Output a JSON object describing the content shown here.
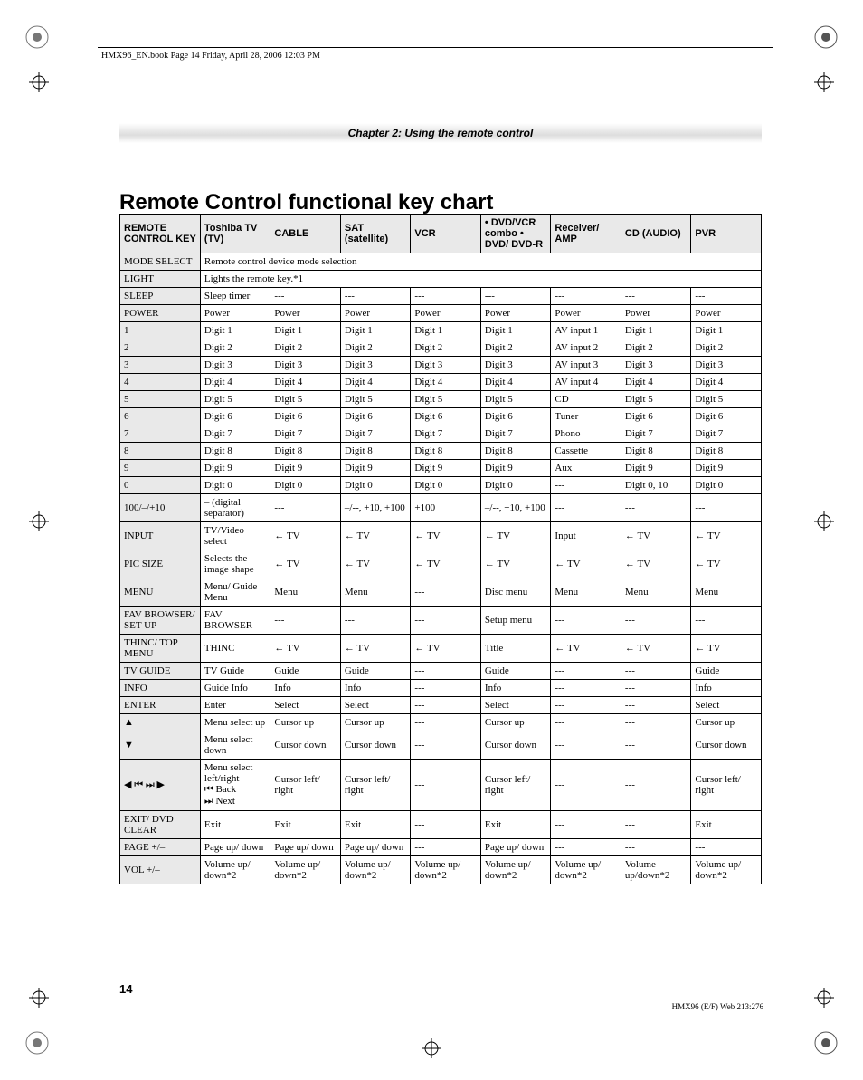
{
  "header": {
    "running": "HMX96_EN.book  Page 14  Friday, April 28, 2006  12:03 PM",
    "chapter": "Chapter 2: Using the remote control"
  },
  "title": "Remote Control functional key chart",
  "columns": [
    "REMOTE CONTROL KEY",
    "Toshiba TV (TV)",
    "CABLE",
    "SAT (satellite)",
    "VCR",
    "• DVD/VCR combo\n• DVD/ DVD-R",
    "Receiver/ AMP",
    "CD (AUDIO)",
    "PVR"
  ],
  "rows": [
    {
      "key": "MODE SELECT",
      "full": "Remote control device mode selection"
    },
    {
      "key": "LIGHT",
      "full": "Lights the remote key.*1"
    },
    {
      "key": "SLEEP",
      "cells": [
        "Sleep timer",
        "---",
        "---",
        "---",
        "---",
        "---",
        "---",
        "---"
      ]
    },
    {
      "key": "POWER",
      "cells": [
        "Power",
        "Power",
        "Power",
        "Power",
        "Power",
        "Power",
        "Power",
        "Power"
      ]
    },
    {
      "key": "1",
      "cells": [
        "Digit 1",
        "Digit 1",
        "Digit 1",
        "Digit 1",
        "Digit 1",
        "AV input 1",
        "Digit 1",
        "Digit 1"
      ]
    },
    {
      "key": "2",
      "cells": [
        "Digit 2",
        "Digit 2",
        "Digit 2",
        "Digit 2",
        "Digit 2",
        "AV input 2",
        "Digit 2",
        "Digit 2"
      ]
    },
    {
      "key": "3",
      "cells": [
        "Digit 3",
        "Digit 3",
        "Digit 3",
        "Digit 3",
        "Digit 3",
        "AV input 3",
        "Digit 3",
        "Digit 3"
      ]
    },
    {
      "key": "4",
      "cells": [
        "Digit 4",
        "Digit 4",
        "Digit 4",
        "Digit 4",
        "Digit 4",
        "AV input 4",
        "Digit 4",
        "Digit 4"
      ]
    },
    {
      "key": "5",
      "cells": [
        "Digit 5",
        "Digit 5",
        "Digit 5",
        "Digit 5",
        "Digit 5",
        "CD",
        "Digit 5",
        "Digit 5"
      ]
    },
    {
      "key": "6",
      "cells": [
        "Digit 6",
        "Digit 6",
        "Digit 6",
        "Digit 6",
        "Digit 6",
        "Tuner",
        "Digit 6",
        "Digit 6"
      ]
    },
    {
      "key": "7",
      "cells": [
        "Digit 7",
        "Digit 7",
        "Digit 7",
        "Digit 7",
        "Digit 7",
        "Phono",
        "Digit 7",
        "Digit 7"
      ]
    },
    {
      "key": "8",
      "cells": [
        "Digit 8",
        "Digit 8",
        "Digit 8",
        "Digit 8",
        "Digit 8",
        "Cassette",
        "Digit 8",
        "Digit 8"
      ]
    },
    {
      "key": "9",
      "cells": [
        "Digit 9",
        "Digit 9",
        "Digit 9",
        "Digit 9",
        "Digit 9",
        "Aux",
        "Digit 9",
        "Digit 9"
      ]
    },
    {
      "key": "0",
      "cells": [
        "Digit 0",
        "Digit 0",
        "Digit 0",
        "Digit 0",
        "Digit 0",
        "---",
        "Digit 0, 10",
        "Digit 0"
      ]
    },
    {
      "key": "100/–/+10",
      "cells": [
        "– (digital separator)",
        "---",
        "–/--, +10, +100",
        "+100",
        "–/--, +10, +100",
        "---",
        "---",
        "---"
      ]
    },
    {
      "key": "INPUT",
      "cells": [
        "TV/Video select",
        "← TV",
        "← TV",
        "← TV",
        "← TV",
        "Input",
        "← TV",
        "← TV"
      ]
    },
    {
      "key": "PIC SIZE",
      "cells": [
        "Selects the image shape",
        "← TV",
        "← TV",
        "← TV",
        "← TV",
        "← TV",
        "← TV",
        "← TV"
      ]
    },
    {
      "key": "MENU",
      "cells": [
        "Menu/ Guide Menu",
        "Menu",
        "Menu",
        "---",
        "Disc menu",
        "Menu",
        "Menu",
        "Menu"
      ]
    },
    {
      "key": "FAV BROWSER/ SET UP",
      "cells": [
        "FAV BROWSER",
        "---",
        "---",
        "---",
        "Setup menu",
        "---",
        "---",
        "---"
      ]
    },
    {
      "key": "THINC/ TOP MENU",
      "cells": [
        "THINC",
        "← TV",
        "← TV",
        "← TV",
        "Title",
        "← TV",
        "← TV",
        "← TV"
      ]
    },
    {
      "key": "TV GUIDE",
      "cells": [
        "TV Guide",
        "Guide",
        "Guide",
        "---",
        "Guide",
        "---",
        "---",
        "Guide"
      ]
    },
    {
      "key": "INFO",
      "cells": [
        "Guide Info",
        "Info",
        "Info",
        "---",
        "Info",
        "---",
        "---",
        "Info"
      ]
    },
    {
      "key": "ENTER",
      "cells": [
        "Enter",
        "Select",
        "Select",
        "---",
        "Select",
        "---",
        "---",
        "Select"
      ]
    },
    {
      "key": "▲",
      "cells": [
        "Menu select up",
        "Cursor up",
        "Cursor up",
        "---",
        "Cursor up",
        "---",
        "---",
        "Cursor up"
      ]
    },
    {
      "key": "▼",
      "cells": [
        "Menu select down",
        "Cursor down",
        "Cursor down",
        "---",
        "Cursor down",
        "---",
        "---",
        "Cursor down"
      ]
    },
    {
      "key": "◀ ⏮ ⏭ ▶",
      "cells": [
        "Menu select left/right\n⏮ Back\n⏭ Next",
        "Cursor left/ right",
        "Cursor left/ right",
        "---",
        "Cursor left/ right",
        "---",
        "---",
        "Cursor left/ right"
      ]
    },
    {
      "key": "EXIT/ DVD CLEAR",
      "cells": [
        "Exit",
        "Exit",
        "Exit",
        "---",
        "Exit",
        "---",
        "---",
        "Exit"
      ]
    },
    {
      "key": "PAGE +/–",
      "cells": [
        "Page up/ down",
        "Page up/ down",
        "Page up/ down",
        "---",
        "Page up/ down",
        "---",
        "---",
        "---"
      ]
    },
    {
      "key": "VOL +/–",
      "cells": [
        "Volume up/ down*2",
        "Volume up/ down*2",
        "Volume up/ down*2",
        "Volume up/ down*2",
        "Volume up/ down*2",
        "Volume up/ down*2",
        "Volume up/down*2",
        "Volume up/ down*2"
      ]
    }
  ],
  "footer": {
    "page": "14",
    "code": "HMX96 (E/F) Web 213:276"
  }
}
